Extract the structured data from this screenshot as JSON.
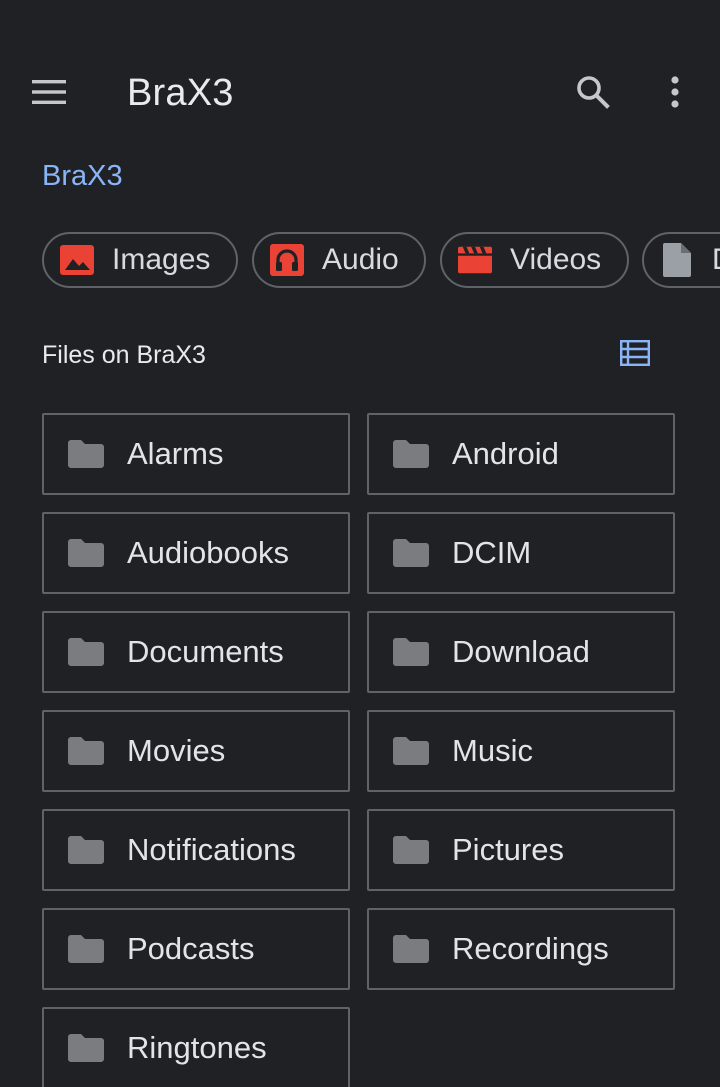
{
  "header": {
    "title": "BraX3",
    "menu_icon": "menu-icon",
    "search_icon": "search-icon",
    "more_icon": "more-vert-icon"
  },
  "breadcrumb": {
    "label": "BraX3"
  },
  "categories": [
    {
      "label": "Images",
      "icon": "image-icon",
      "color": "#ea4335"
    },
    {
      "label": "Audio",
      "icon": "headphones-icon",
      "color": "#ea4335"
    },
    {
      "label": "Videos",
      "icon": "movie-icon",
      "color": "#ea4335"
    },
    {
      "label": "D",
      "icon": "document-icon",
      "color": "#9aa0a6"
    }
  ],
  "section": {
    "title": "Files on BraX3",
    "view_toggle_icon": "list-view-icon"
  },
  "folders": [
    {
      "label": "Alarms"
    },
    {
      "label": "Android"
    },
    {
      "label": "Audiobooks"
    },
    {
      "label": "DCIM"
    },
    {
      "label": "Documents"
    },
    {
      "label": "Download"
    },
    {
      "label": "Movies"
    },
    {
      "label": "Music"
    },
    {
      "label": "Notifications"
    },
    {
      "label": "Pictures"
    },
    {
      "label": "Podcasts"
    },
    {
      "label": "Recordings"
    },
    {
      "label": "Ringtones"
    }
  ],
  "colors": {
    "background": "#202124",
    "accent": "#8ab4f8",
    "border": "#5f6368",
    "folder_icon": "#7a7c80"
  }
}
